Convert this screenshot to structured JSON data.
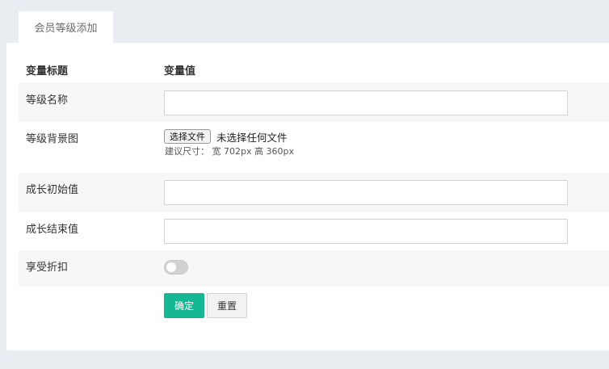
{
  "tabs": [
    {
      "label": "会员等级添加",
      "active": true
    }
  ],
  "table": {
    "headers": {
      "title": "变量标题",
      "value": "变量值"
    }
  },
  "fields": {
    "level_name": {
      "label": "等级名称",
      "value": "",
      "placeholder": ""
    },
    "level_bg": {
      "label": "等级背景图",
      "button": "选择文件",
      "status": "未选择任何文件",
      "hint": "建议尺寸：  宽 702px 高 360px"
    },
    "growth_start": {
      "label": "成长初始值",
      "value": "",
      "placeholder": ""
    },
    "growth_end": {
      "label": "成长结束值",
      "value": "",
      "placeholder": ""
    },
    "discount": {
      "label": "享受折扣",
      "enabled": false
    }
  },
  "actions": {
    "confirm": "确定",
    "reset": "重置"
  },
  "colors": {
    "primary": "#16b894",
    "page_bg": "#e9edf2",
    "row_alt": "#f7f7f7"
  }
}
